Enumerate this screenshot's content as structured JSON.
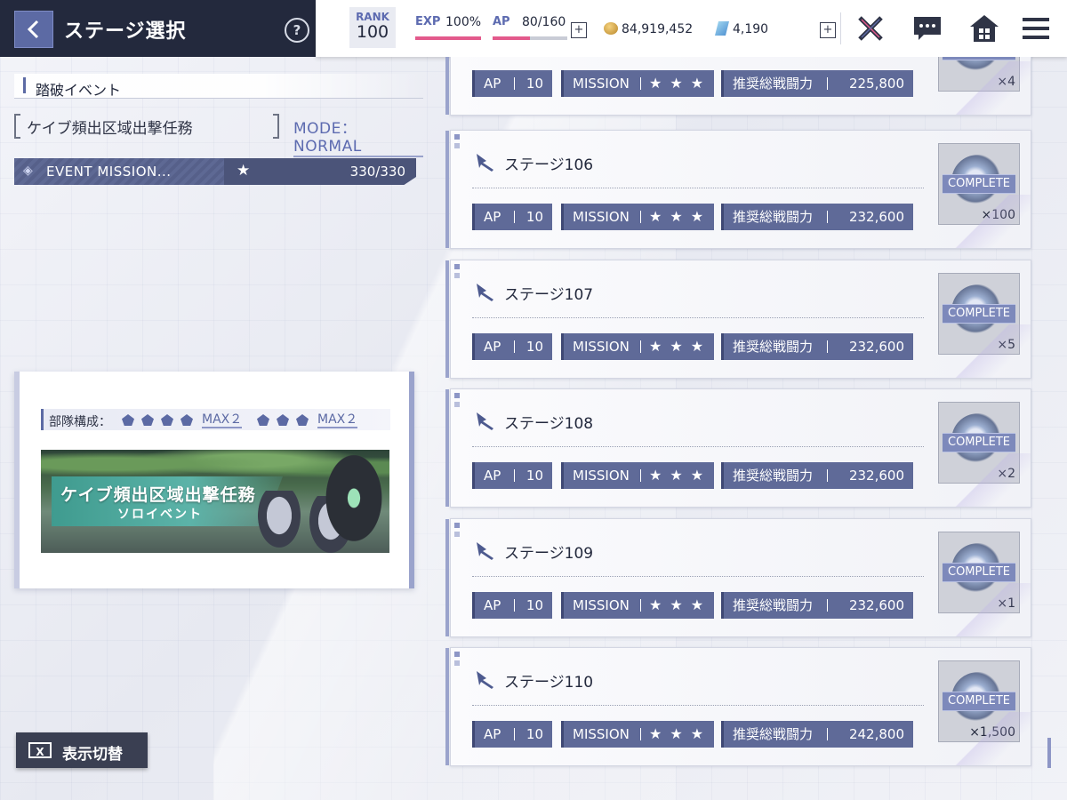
{
  "header": {
    "title": "ステージ選択",
    "help_label": "?",
    "rank_label": "RANK",
    "rank_value": "100",
    "exp_label": "EXP",
    "exp_value": "100%",
    "exp_fill": 1.0,
    "ap_label": "AP",
    "ap_value": "80/160",
    "ap_fill": 0.5,
    "plus": "+",
    "coins": "84,919,452",
    "gems": "4,190",
    "icons": [
      "back-icon",
      "help-icon",
      "coin-icon",
      "gem-icon",
      "battle-icon",
      "chat-icon",
      "home-icon",
      "menu-icon"
    ]
  },
  "left_panel": {
    "category": "踏破イベント",
    "mission_name": "ケイブ頻出区域出撃任務",
    "mode": "MODE：NORMAL",
    "event_mission_label": "EVENT MISSION...",
    "event_mission_star": "★",
    "event_mission_count": "330/330",
    "party_label": "部隊構成：",
    "party_max_1": "MAX２",
    "party_max_2": "MAX２",
    "banner_title": "ケイブ頻出区域出撃任務",
    "banner_subtitle": "ソロイベント",
    "display_toggle_icon": "X",
    "display_toggle": "表示切替"
  },
  "chip_labels": {
    "ap": "AP",
    "mission": "MISSION",
    "power": "推奨総戦闘力",
    "stars": "★★★",
    "complete": "COMPLETE"
  },
  "stages": [
    {
      "name": "",
      "ap": "10",
      "power": "225,800",
      "reward_count": "×4"
    },
    {
      "name": "ステージ106",
      "ap": "10",
      "power": "232,600",
      "reward_count": "×100"
    },
    {
      "name": "ステージ107",
      "ap": "10",
      "power": "232,600",
      "reward_count": "×5"
    },
    {
      "name": "ステージ108",
      "ap": "10",
      "power": "232,600",
      "reward_count": "×2"
    },
    {
      "name": "ステージ109",
      "ap": "10",
      "power": "232,600",
      "reward_count": "×1"
    },
    {
      "name": "ステージ110",
      "ap": "10",
      "power": "242,800",
      "reward_count": "×1,500"
    }
  ],
  "colors": {
    "accent": "#5c6aa4",
    "header_dark": "#23293d",
    "exp_bar": "#e35a8c",
    "chip": "#5f6a98"
  }
}
